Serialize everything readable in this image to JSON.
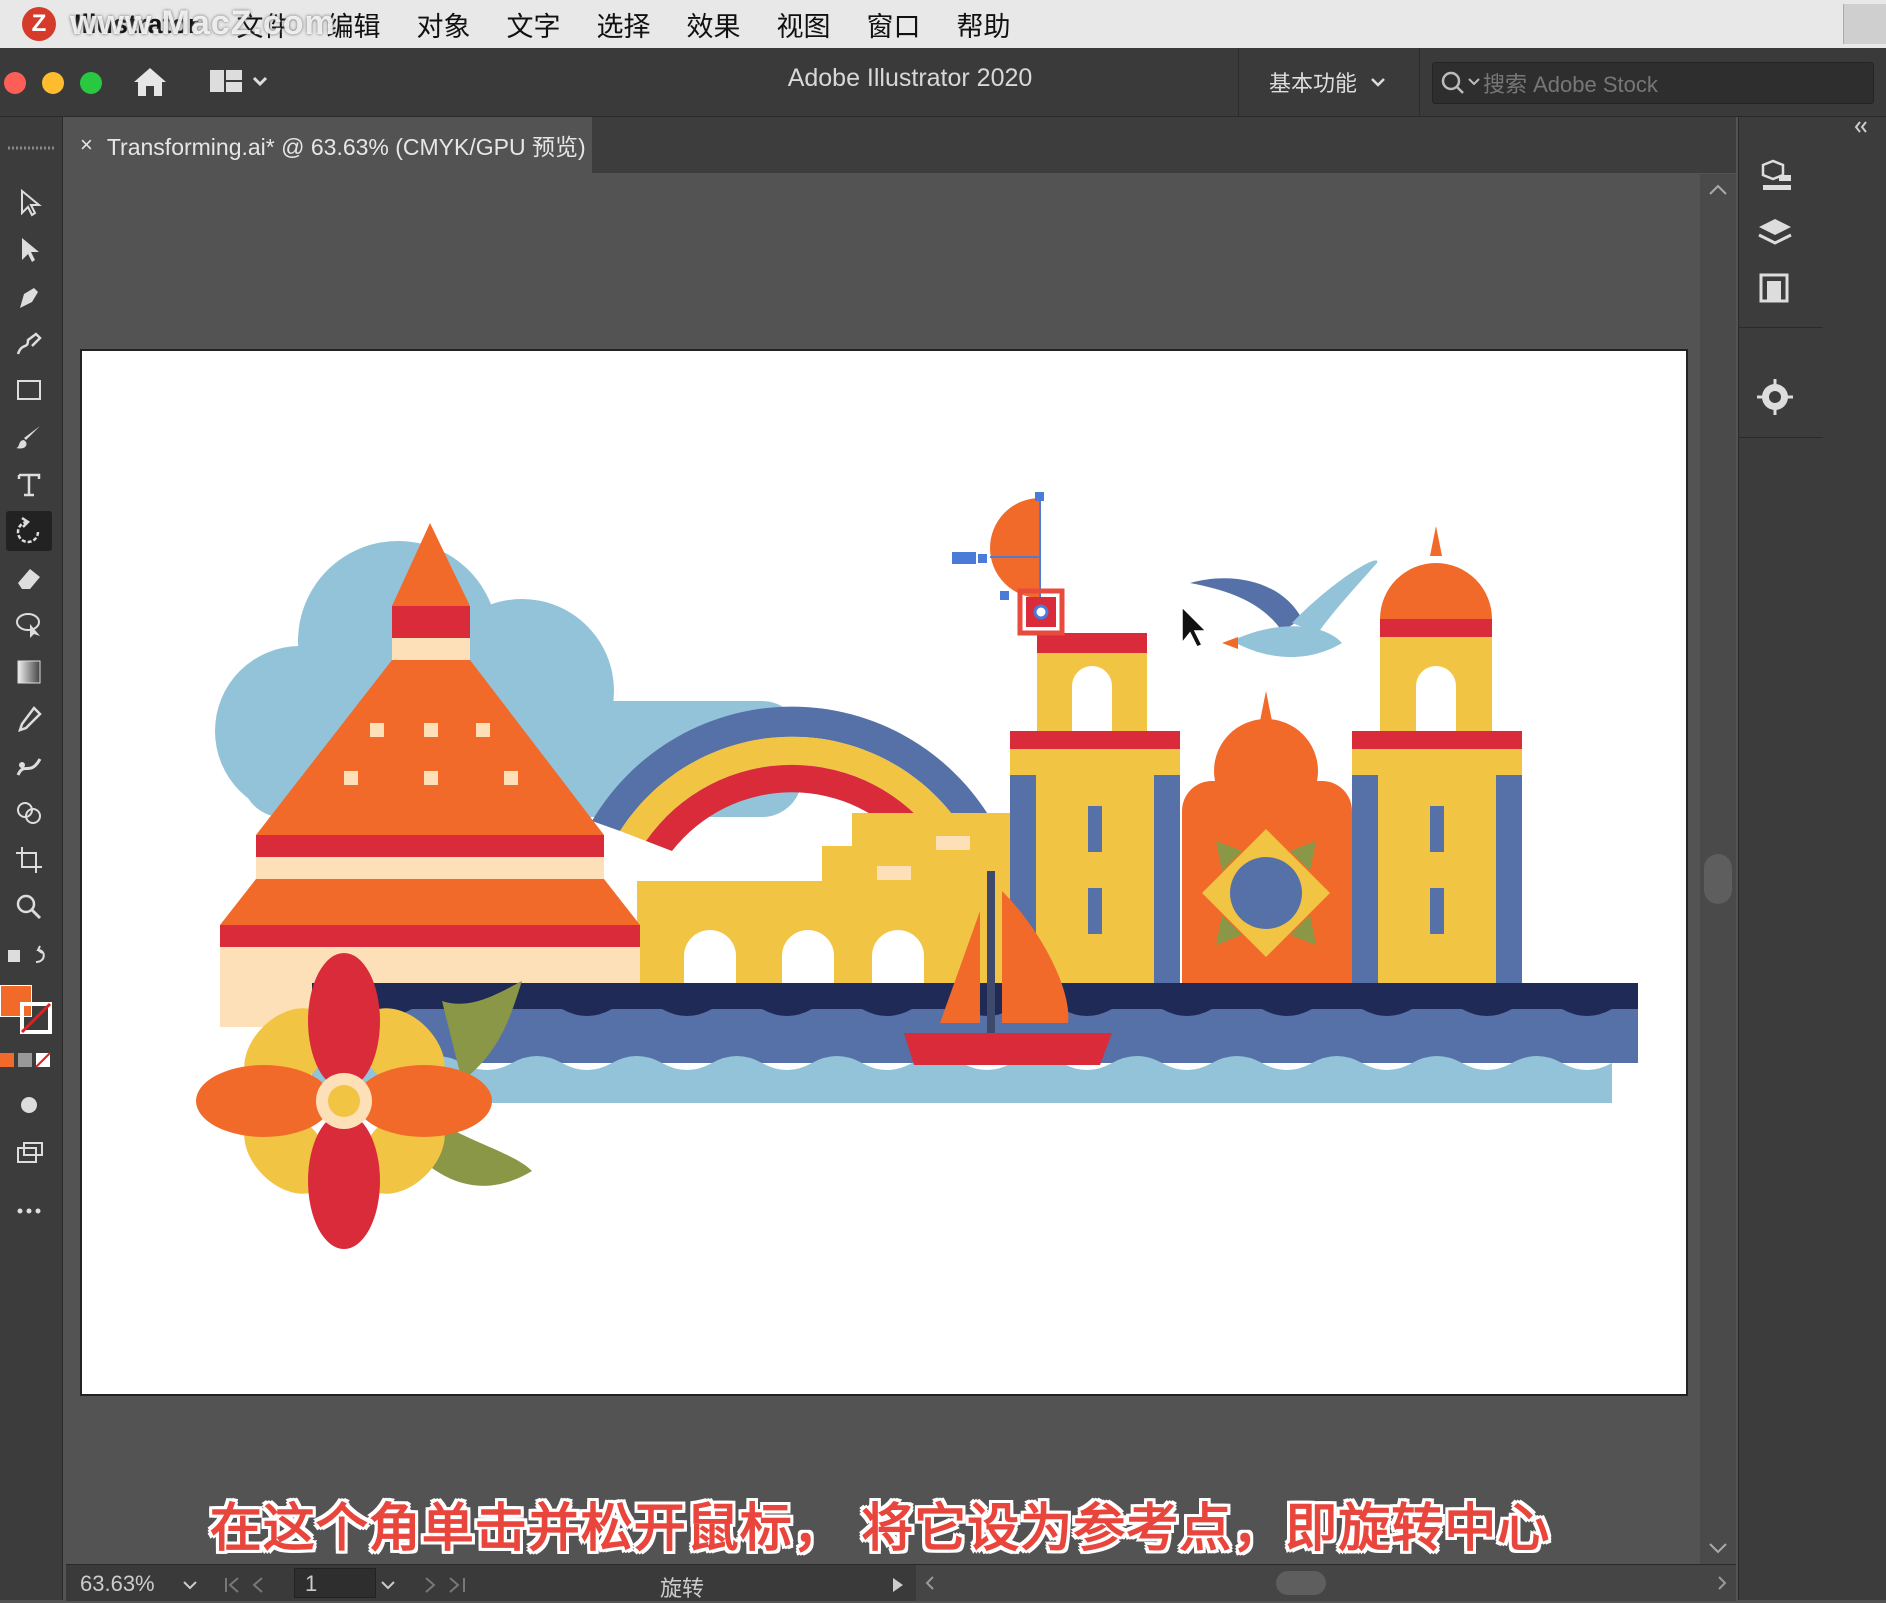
{
  "menubar": {
    "app_name": "Illustrator",
    "watermark": "www.MacZ.com",
    "items": [
      "文件",
      "编辑",
      "对象",
      "文字",
      "选择",
      "效果",
      "视图",
      "窗口",
      "帮助"
    ]
  },
  "appbar": {
    "title": "Adobe Illustrator 2020",
    "workspace": "基本功能",
    "search_placeholder": "搜索 Adobe Stock"
  },
  "document_tab": {
    "close": "×",
    "label": "Transforming.ai* @ 63.63% (CMYK/GPU 预览)"
  },
  "tools": [
    "selection-tool",
    "direct-selection-tool",
    "pen-tool",
    "curvature-tool",
    "rectangle-tool",
    "paintbrush-tool",
    "type-tool",
    "rotate-tool",
    "eraser-tool",
    "lasso-tool",
    "gradient-tool",
    "eyedropper-tool",
    "puppet-warp-tool",
    "shape-builder-tool",
    "artboard-tool",
    "zoom-tool"
  ],
  "toolbar_colors": {
    "fill": "#f26a2a",
    "stroke": "none"
  },
  "statusbar": {
    "zoom": "63.63%",
    "artboard_number": "1",
    "tool_name": "旋转"
  },
  "subtitle": "在这个角单击并松开鼠标， 将它设为参考点，即旋转中心",
  "colors": {
    "orange": "#f26a2a",
    "red": "#d92b3a",
    "yellow": "#f2c443",
    "blue": "#5571a8",
    "light_blue": "#92c3d8",
    "navy": "#1f2a56",
    "cream": "#fde0b8",
    "olive": "#899747",
    "selection": "#4a7bd8"
  }
}
